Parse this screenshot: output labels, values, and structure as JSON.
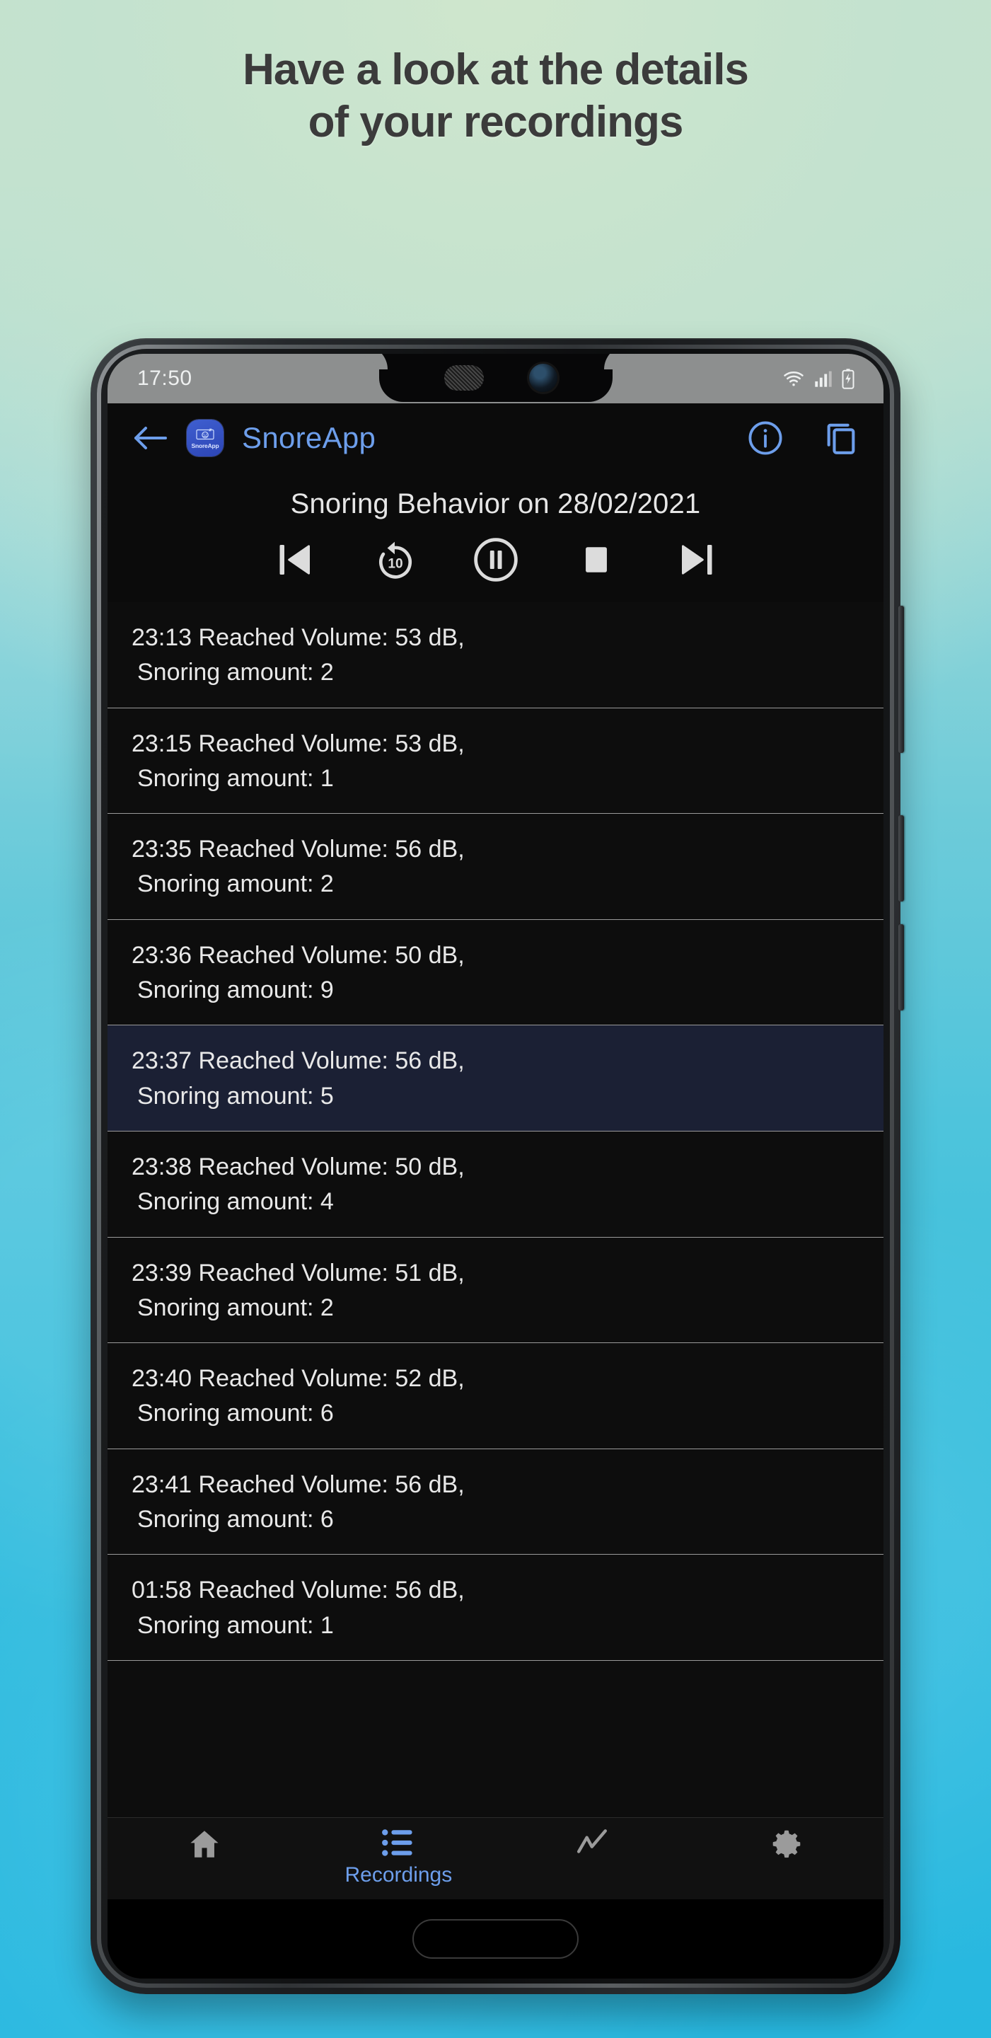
{
  "promo": {
    "headline_line1": "Have a look at the details",
    "headline_line2": "of your recordings",
    "text_color": "#3b3b3b",
    "bg_top_color": "#cbe5cc",
    "bg_bottom_color": "#27b8e0"
  },
  "statusbar": {
    "time": "17:50",
    "icons": [
      "wifi-icon",
      "cellular-signal-icon",
      "battery-charging-icon"
    ]
  },
  "appbar": {
    "back_icon": "arrow-left-icon",
    "logo_label": "SnoreApp",
    "title": "SnoreApp",
    "info_icon": "info-circle-icon",
    "copy_icon": "copy-layers-icon",
    "accent_color": "#6d9eeb"
  },
  "page": {
    "title": "Snoring Behavior on 28/02/2021"
  },
  "controls": [
    {
      "name": "skip-previous-button",
      "icon": "skip-previous-icon",
      "label": ""
    },
    {
      "name": "rewind-10-button",
      "icon": "rewind-10-icon",
      "label": "10"
    },
    {
      "name": "pause-button",
      "icon": "pause-circle-icon",
      "label": ""
    },
    {
      "name": "stop-button",
      "icon": "stop-icon",
      "label": ""
    },
    {
      "name": "skip-next-button",
      "icon": "skip-next-icon",
      "label": ""
    }
  ],
  "list": {
    "selected_index": 4,
    "selected_bg": "#1b2034",
    "rows": [
      {
        "line1": "23:13 Reached Volume: 53 dB,",
        "line2": "Snoring amount: 2",
        "time": "23:13",
        "volume_db": 53,
        "snoring_amount": 2
      },
      {
        "line1": "23:15 Reached Volume: 53 dB,",
        "line2": "Snoring amount: 1",
        "time": "23:15",
        "volume_db": 53,
        "snoring_amount": 1
      },
      {
        "line1": "23:35 Reached Volume: 56 dB,",
        "line2": "Snoring amount: 2",
        "time": "23:35",
        "volume_db": 56,
        "snoring_amount": 2
      },
      {
        "line1": "23:36 Reached Volume: 50 dB,",
        "line2": "Snoring amount: 9",
        "time": "23:36",
        "volume_db": 50,
        "snoring_amount": 9
      },
      {
        "line1": "23:37 Reached Volume: 56 dB,",
        "line2": "Snoring amount: 5",
        "time": "23:37",
        "volume_db": 56,
        "snoring_amount": 5
      },
      {
        "line1": "23:38 Reached Volume: 50 dB,",
        "line2": "Snoring amount: 4",
        "time": "23:38",
        "volume_db": 50,
        "snoring_amount": 4
      },
      {
        "line1": "23:39 Reached Volume: 51 dB,",
        "line2": "Snoring amount: 2",
        "time": "23:39",
        "volume_db": 51,
        "snoring_amount": 2
      },
      {
        "line1": "23:40 Reached Volume: 52 dB,",
        "line2": "Snoring amount: 6",
        "time": "23:40",
        "volume_db": 52,
        "snoring_amount": 6
      },
      {
        "line1": "23:41 Reached Volume: 56 dB,",
        "line2": "Snoring amount: 6",
        "time": "23:41",
        "volume_db": 56,
        "snoring_amount": 6
      },
      {
        "line1": "01:58 Reached Volume: 56 dB,",
        "line2": "Snoring amount: 1",
        "time": "01:58",
        "volume_db": 56,
        "snoring_amount": 1
      }
    ]
  },
  "bottomnav": {
    "active_index": 1,
    "active_color": "#6d9eeb",
    "inactive_color": "#9b9b9b",
    "items": [
      {
        "name": "nav-home",
        "icon": "home-icon",
        "label": ""
      },
      {
        "name": "nav-recordings",
        "icon": "list-icon",
        "label": "Recordings"
      },
      {
        "name": "nav-statistics",
        "icon": "trend-line-icon",
        "label": ""
      },
      {
        "name": "nav-settings",
        "icon": "gear-icon",
        "label": ""
      }
    ]
  }
}
